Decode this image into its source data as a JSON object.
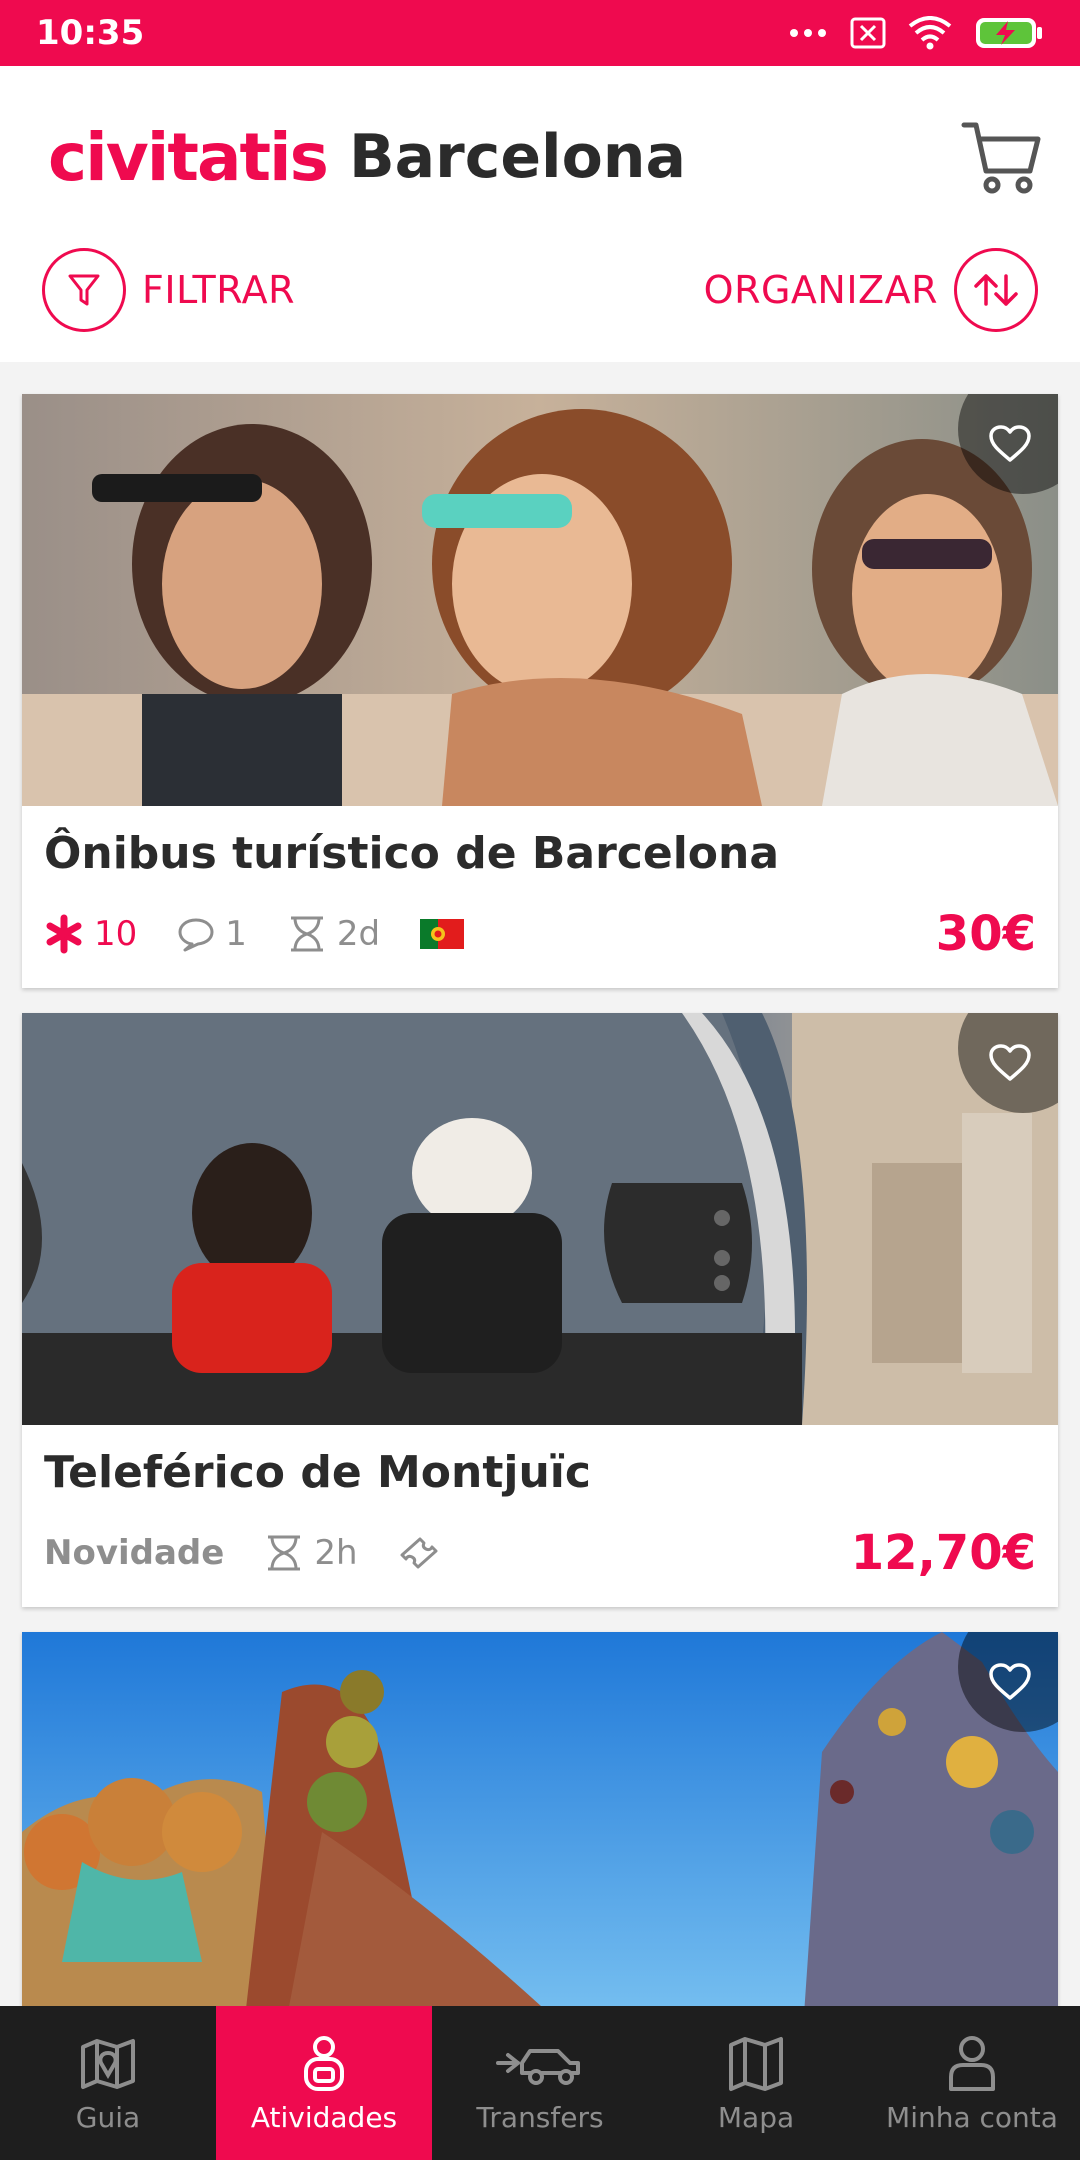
{
  "status_bar": {
    "time": "10:35",
    "icons": [
      "more-dots-icon",
      "sim-off-icon",
      "wifi-icon",
      "battery-charging-icon"
    ]
  },
  "header": {
    "brand": "civitatis",
    "city": "Barcelona",
    "cart_icon": "cart-icon"
  },
  "actions": {
    "filter_label": "FILTRAR",
    "sort_label": "ORGANIZAR"
  },
  "cards": [
    {
      "title": "Ônibus turístico de Barcelona",
      "rating": "10",
      "comments": "1",
      "duration": "2d",
      "language_flag": "portugal-flag-icon",
      "price": "30€"
    },
    {
      "title": "Teleférico de Montjuïc",
      "badge": "Novidade",
      "duration": "2h",
      "ticket_icon": "ticket-icon",
      "price": "12,70€"
    },
    {
      "title": ""
    }
  ],
  "bottom_nav": [
    {
      "label": "Guia",
      "icon": "map-pin-icon",
      "active": false
    },
    {
      "label": "Atividades",
      "icon": "activities-icon",
      "active": true
    },
    {
      "label": "Transfers",
      "icon": "car-icon",
      "active": false
    },
    {
      "label": "Mapa",
      "icon": "map-icon",
      "active": false
    },
    {
      "label": "Minha conta",
      "icon": "user-icon",
      "active": false
    }
  ],
  "colors": {
    "brand": "#ef0a4f",
    "nav_bg": "#1e1e1e",
    "text": "#2b2b2b"
  }
}
